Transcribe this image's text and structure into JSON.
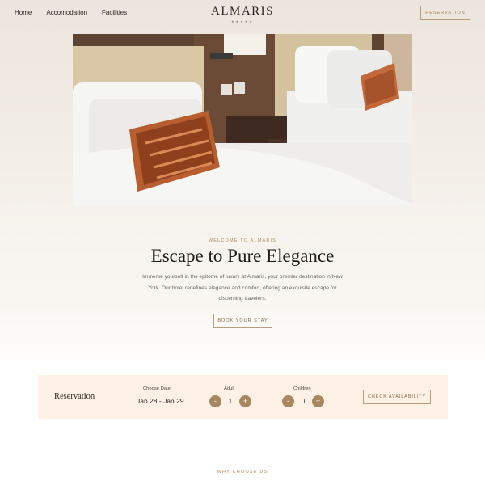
{
  "nav": {
    "links": [
      "Home",
      "Accomodation",
      "Facilities"
    ],
    "logo": "ALMARIS",
    "logo_stars": "★★★★★",
    "reservation_button": "RESERVATION"
  },
  "hero": {
    "image_alt": "Hotel twin bedroom with white linens and orange patterned pillows",
    "eyebrow": "WELCOME TO ALMARIS",
    "title": "Escape to Pure Elegance",
    "description": "Immerse yourself in the epitome of luxury at Almaris, your premier destination in New York. Our hotel redefines elegance and comfort, offering an exquisite escape for discerning travelers.",
    "cta": "BOOK YOUR STAY"
  },
  "reservation": {
    "title": "Reservation",
    "date_label": "Choose Date",
    "date_value": "Jan 28 - Jan 29",
    "adult_label": "Adult",
    "adult_count": "1",
    "children_label": "Children",
    "children_count": "0",
    "minus": "-",
    "plus": "+",
    "check_button": "CHECK AVAILABILITY"
  },
  "why_choose": "WHY CHOOSE US",
  "colors": {
    "accent": "#a8865f",
    "bar_bg": "#fdf1e6",
    "text": "#2b2622"
  }
}
